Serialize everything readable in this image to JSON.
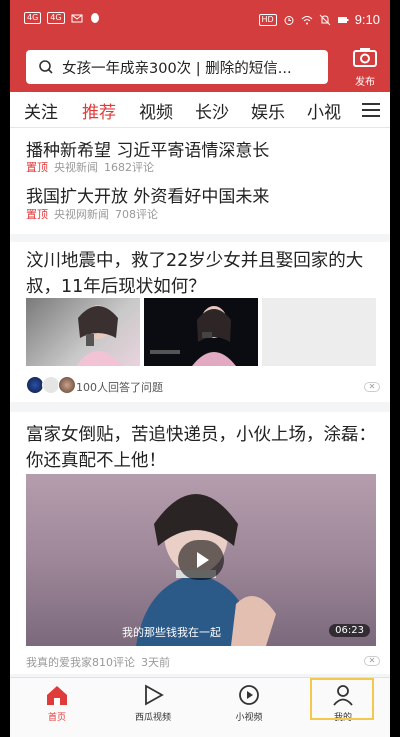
{
  "status_bar": {
    "left_indicators": [
      "4G",
      "4G"
    ],
    "right_badge": "HD",
    "time": "9:10"
  },
  "header": {
    "search_placeholder": "女孩一年成亲300次 | 删除的短信...",
    "publish_label": "发布"
  },
  "tabs": [
    "关注",
    "推荐",
    "视频",
    "长沙",
    "娱乐",
    "小视"
  ],
  "active_tab": "推荐",
  "headlines": [
    {
      "title": "播种新希望 习近平寄语情深意长",
      "pin": "置顶",
      "source": "央视新闻",
      "comments": "1682评论"
    },
    {
      "title": "我国扩大开放 外资看好中国未来",
      "pin": "置顶",
      "source": "央视网新闻",
      "comments": "708评论"
    }
  ],
  "qa_card": {
    "title": "汶川地震中，救了22岁少女并且娶回家的大叔，11年后现状如何？",
    "answers_text": "100人回答了问题"
  },
  "video_card": {
    "title": "富家女倒贴，苦追快递员，小伙上场，涂磊：你还真配不上他！",
    "subtitle_overlay": "我的那些钱我在一起",
    "duration": "06:23",
    "source": "我真的爱我家",
    "comments": "810评论",
    "time_ago": "3天前"
  },
  "bottom_nav": [
    {
      "label": "首页",
      "icon": "home-icon"
    },
    {
      "label": "西瓜视频",
      "icon": "play-triangle-icon"
    },
    {
      "label": "小视频",
      "icon": "mini-video-icon"
    },
    {
      "label": "我的",
      "icon": "user-icon"
    }
  ],
  "colors": {
    "brand_red": "#d43d3d",
    "active_red": "#e03b3b",
    "highlight": "#f2c94c"
  }
}
